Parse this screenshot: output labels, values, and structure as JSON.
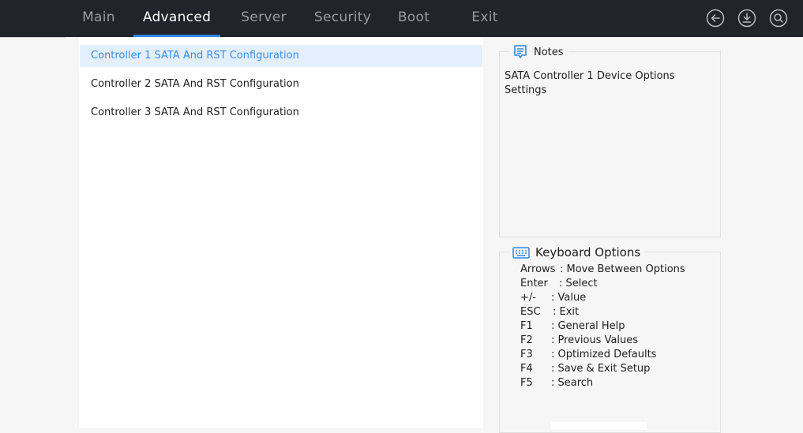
{
  "tabs": [
    {
      "label": "Main",
      "active": false
    },
    {
      "label": "Advanced",
      "active": true
    },
    {
      "label": "Server",
      "active": false
    },
    {
      "label": "Security",
      "active": false
    },
    {
      "label": "Boot",
      "active": false
    },
    {
      "label": "Exit",
      "active": false
    }
  ],
  "top_icons": [
    "back-arrow-icon",
    "download-icon",
    "search-icon"
  ],
  "menu": {
    "items": [
      {
        "label": "Controller 1 SATA And RST Configuration",
        "selected": true
      },
      {
        "label": "Controller 2 SATA And RST Configuration",
        "selected": false
      },
      {
        "label": "Controller 3 SATA And RST Configuration",
        "selected": false
      }
    ]
  },
  "notes": {
    "title": "Notes",
    "text": "SATA Controller 1 Device Options Settings"
  },
  "keyboard": {
    "title": "Keyboard Options",
    "rows": [
      {
        "key": "Arrows",
        "desc": ": Move Between Options"
      },
      {
        "key": "Enter",
        "desc": ": Select"
      },
      {
        "key": "+/-",
        "desc": ": Value"
      },
      {
        "key": "ESC",
        "desc": ": Exit"
      },
      {
        "key": "F1",
        "desc": ": General Help"
      },
      {
        "key": "F2",
        "desc": ": Previous Values"
      },
      {
        "key": "F3",
        "desc": ": Optimized Defaults"
      },
      {
        "key": "F4",
        "desc": ": Save & Exit Setup"
      },
      {
        "key": "F5",
        "desc": ": Search"
      }
    ]
  },
  "colors": {
    "topbar": "#22242c",
    "accent": "#2f8ae5",
    "selected_bg": "#e3effc",
    "selected_text": "#3a8ee6"
  }
}
